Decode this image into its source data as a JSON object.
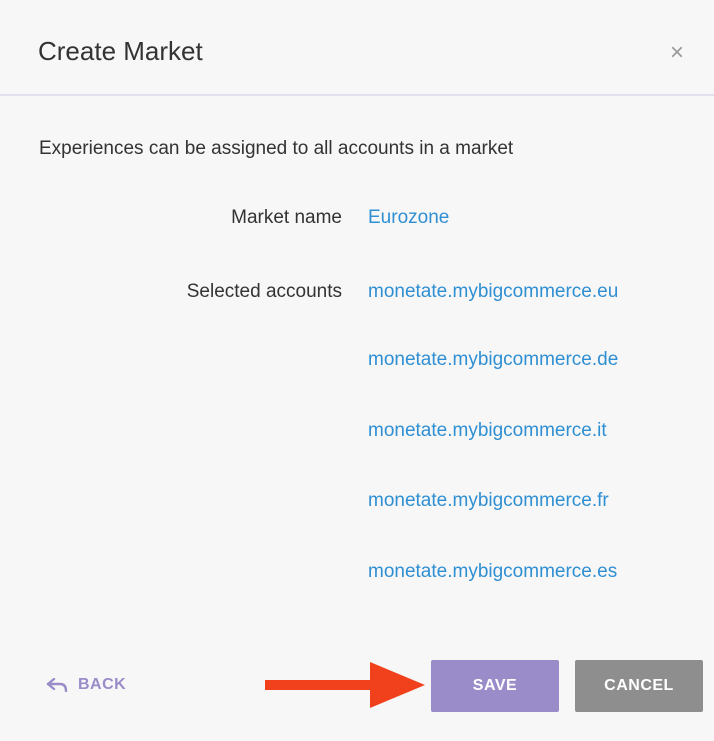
{
  "dialog": {
    "title": "Create Market",
    "close_symbol": "×",
    "description": "Experiences can be assigned to all accounts in a market"
  },
  "fields": {
    "market_name_label": "Market name",
    "market_name_value": "Eurozone",
    "selected_accounts_label": "Selected accounts",
    "accounts": [
      "monetate.mybigcommerce.eu",
      "monetate.mybigcommerce.de",
      "monetate.mybigcommerce.it",
      "monetate.mybigcommerce.fr",
      "monetate.mybigcommerce.es"
    ]
  },
  "footer": {
    "back_label": "BACK",
    "back_icon": "reply-arrow-icon",
    "save_label": "SAVE",
    "cancel_label": "CANCEL"
  },
  "colors": {
    "accent_purple": "#9a8cc8",
    "link_blue": "#2f8fd3",
    "cancel_gray": "#8e8e8e",
    "annotation_arrow": "#f0401c"
  }
}
